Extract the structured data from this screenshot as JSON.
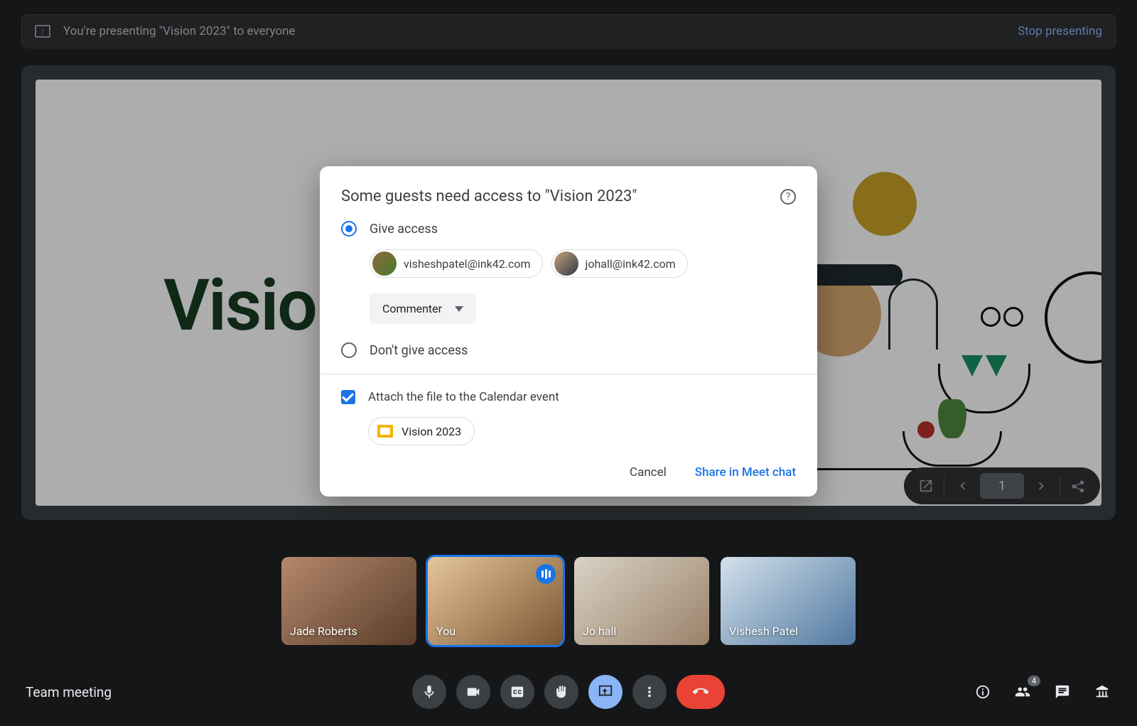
{
  "presenting_banner": {
    "message": "You're presenting \"Vision 2023\" to everyone",
    "stop_label": "Stop presenting"
  },
  "slide": {
    "title": "Visio"
  },
  "slides_toolbar": {
    "page_number": "1"
  },
  "dialog": {
    "title": "Some guests need access to \"Vision 2023\"",
    "option_give": "Give access",
    "option_deny": "Don't give access",
    "people": [
      {
        "email": "visheshpatel@ink42.com"
      },
      {
        "email": "johall@ink42.com"
      }
    ],
    "role": "Commenter",
    "attach_label": "Attach the file to the Calendar event",
    "file_name": "Vision 2023",
    "cancel": "Cancel",
    "share": "Share in Meet chat"
  },
  "filmstrip": [
    {
      "name": "Jade Roberts",
      "speaking": false,
      "active": false
    },
    {
      "name": "You",
      "speaking": true,
      "active": true
    },
    {
      "name": "Jo hall",
      "speaking": false,
      "active": false
    },
    {
      "name": "Vishesh Patel",
      "speaking": false,
      "active": false
    }
  ],
  "bottom": {
    "meeting_name": "Team meeting",
    "people_count": "4"
  }
}
